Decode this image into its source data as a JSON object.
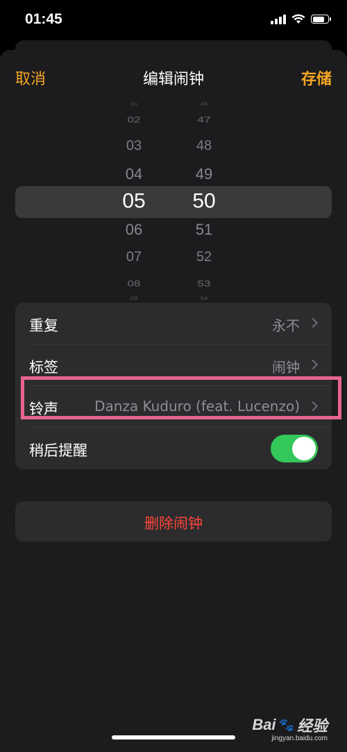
{
  "status_bar": {
    "time": "01:45"
  },
  "nav": {
    "cancel": "取消",
    "title": "编辑闹钟",
    "save": "存储"
  },
  "picker": {
    "hours": [
      "01",
      "02",
      "03",
      "04",
      "05",
      "06",
      "07",
      "08",
      "09"
    ],
    "minutes": [
      "46",
      "47",
      "48",
      "49",
      "50",
      "51",
      "52",
      "53",
      "54"
    ],
    "selected_hour": "05",
    "selected_minute": "50"
  },
  "settings": {
    "repeat": {
      "label": "重复",
      "value": "永不"
    },
    "label": {
      "label": "标签",
      "value": "闹钟"
    },
    "sound": {
      "label": "铃声",
      "value": "Danza Kuduro (feat. Lucenzo)"
    },
    "snooze": {
      "label": "稍后提醒",
      "enabled": true
    }
  },
  "delete_button": "删除闹钟",
  "watermark": {
    "brand": "Bai",
    "brand2": "经验",
    "site": "jingyan.baidu.com"
  },
  "colors": {
    "accent": "#f5a623",
    "destructive": "#ff453a",
    "toggle_on": "#34c759"
  }
}
